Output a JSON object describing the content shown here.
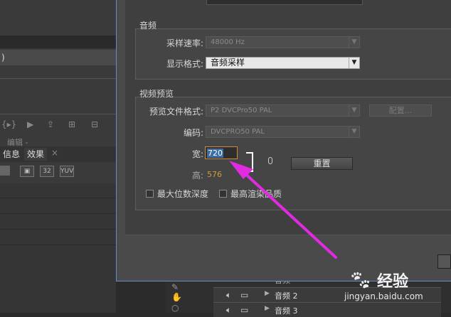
{
  "audio": {
    "group_title": "音频",
    "sample_rate_label": "采样速率:",
    "sample_rate_value": "48000 Hz",
    "display_format_label": "显示格式:",
    "display_format_value": "音频采样"
  },
  "video_preview": {
    "group_title": "视频预览",
    "file_format_label": "预览文件格式:",
    "file_format_value": "P2 DVCPro50 PAL",
    "configure_label": "配置...",
    "codec_label": "编码:",
    "codec_value": "DVCPRO50 PAL",
    "width_label": "宽:",
    "width_value": "720",
    "height_label": "高:",
    "height_value": "576",
    "reset_label": "重置",
    "max_bit_depth_label": "最大位数深度",
    "max_render_quality_label": "最高渲染品质"
  },
  "background": {
    "row_text": ")",
    "edit_text": "编辑 -",
    "tab_info": "信息",
    "tab_effects": "效果",
    "icon_32": "32",
    "icon_yuv": "YUV",
    "track_audio2": "音频 2",
    "track_audio3": "音频 3",
    "track_partial": "音频"
  },
  "watermark": {
    "brand": "经验",
    "url": "jingyan.baidu.com"
  },
  "colors": {
    "accent_arrow": "#e02be0",
    "dialog_border": "#6a8cc5",
    "number_orange": "#d49a3a"
  }
}
